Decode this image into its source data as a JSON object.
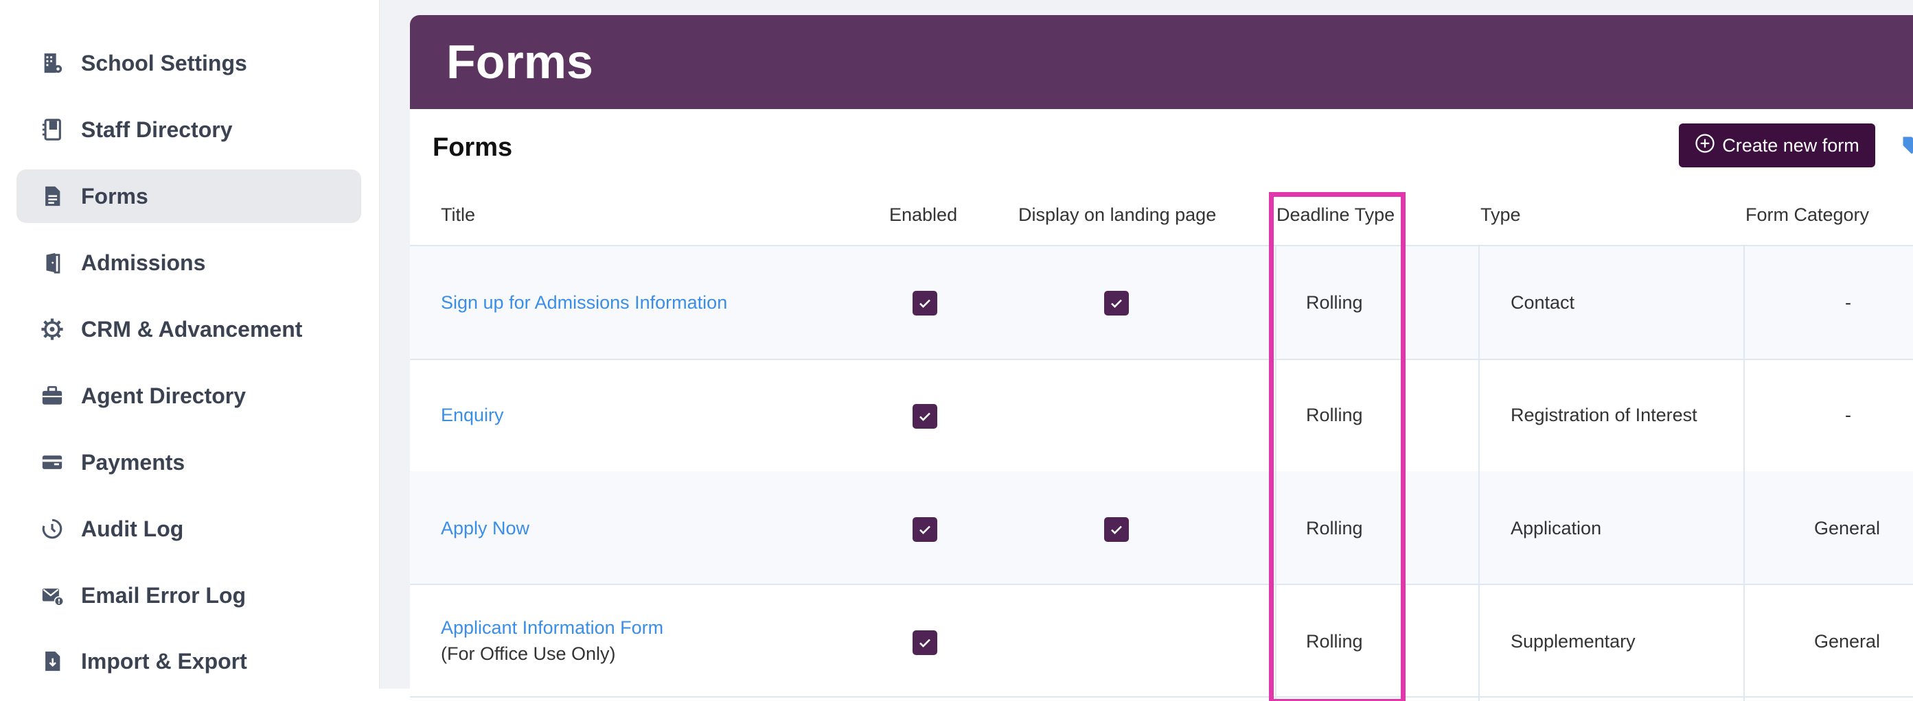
{
  "sidebar": {
    "items": [
      {
        "label": "School Settings",
        "icon": "building-icon",
        "active": false
      },
      {
        "label": "Staff Directory",
        "icon": "staff-book-icon",
        "active": false
      },
      {
        "label": "Forms",
        "icon": "document-icon",
        "active": true
      },
      {
        "label": "Admissions",
        "icon": "door-icon",
        "active": false
      },
      {
        "label": "CRM & Advancement",
        "icon": "gear-icon",
        "active": false
      },
      {
        "label": "Agent Directory",
        "icon": "briefcase-icon",
        "active": false
      },
      {
        "label": "Payments",
        "icon": "wallet-icon",
        "active": false
      },
      {
        "label": "Audit Log",
        "icon": "history-icon",
        "active": false
      },
      {
        "label": "Email Error Log",
        "icon": "email-error-icon",
        "active": false
      },
      {
        "label": "Import & Export",
        "icon": "file-download-icon",
        "active": false
      }
    ]
  },
  "header": {
    "title": "Forms"
  },
  "section": {
    "title": "Forms",
    "create_button": "Create new form"
  },
  "table": {
    "columns": [
      "Title",
      "Enabled",
      "Display on landing page",
      "Deadline Type",
      "Type",
      "Form Category"
    ],
    "rows": [
      {
        "title": "Sign up for Admissions Information",
        "note": "",
        "enabled": true,
        "landing": true,
        "deadline": "Rolling",
        "type": "Contact",
        "category": "-"
      },
      {
        "title": "Enquiry",
        "note": "",
        "enabled": true,
        "landing": false,
        "deadline": "Rolling",
        "type": "Registration of Interest",
        "category": "-"
      },
      {
        "title": "Apply Now",
        "note": "",
        "enabled": true,
        "landing": true,
        "deadline": "Rolling",
        "type": "Application",
        "category": "General"
      },
      {
        "title": "Applicant Information Form",
        "note": "(For Office Use Only)",
        "enabled": true,
        "landing": false,
        "deadline": "Rolling",
        "type": "Supplementary",
        "category": "General"
      }
    ]
  },
  "colors": {
    "banner": "#5c3460",
    "button": "#3d0f3f",
    "checkbox": "#4f2354",
    "link": "#3a8ee6",
    "highlight": "#e236ad"
  }
}
